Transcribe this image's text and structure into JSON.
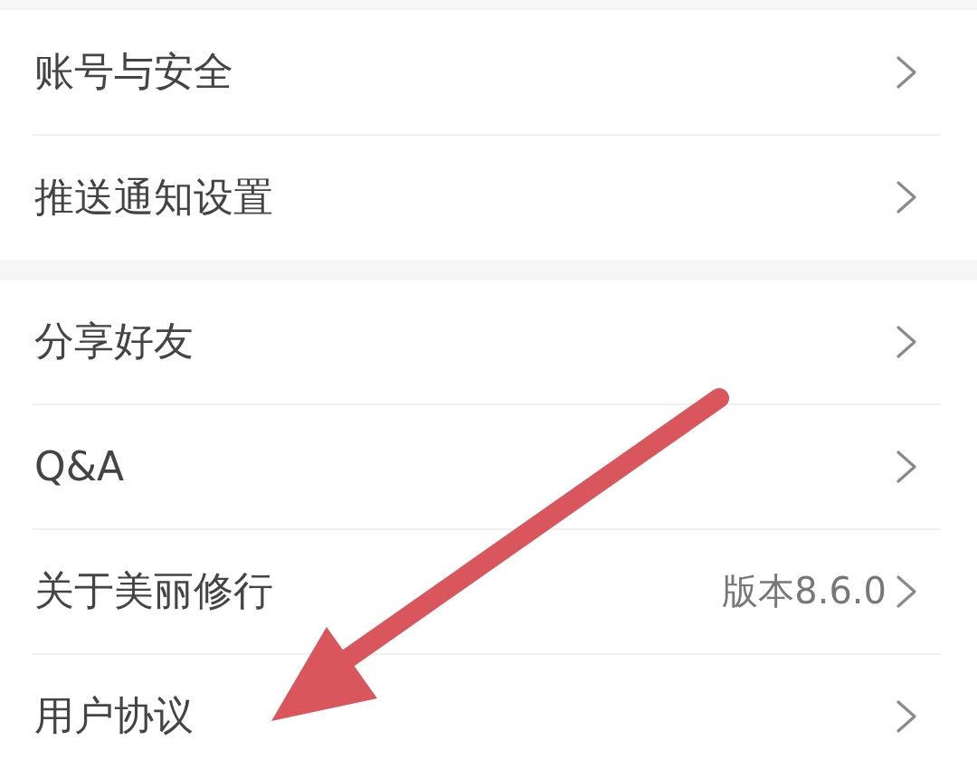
{
  "sections": [
    {
      "items": [
        {
          "label": "账号与安全"
        },
        {
          "label": "推送通知设置"
        }
      ]
    },
    {
      "items": [
        {
          "label": "分享好友"
        },
        {
          "label": "Q&A"
        },
        {
          "label": "关于美丽修行",
          "value": "版本8.6.0"
        },
        {
          "label": "用户协议"
        }
      ]
    }
  ],
  "annotations": [
    {
      "kind": "arrow"
    }
  ]
}
